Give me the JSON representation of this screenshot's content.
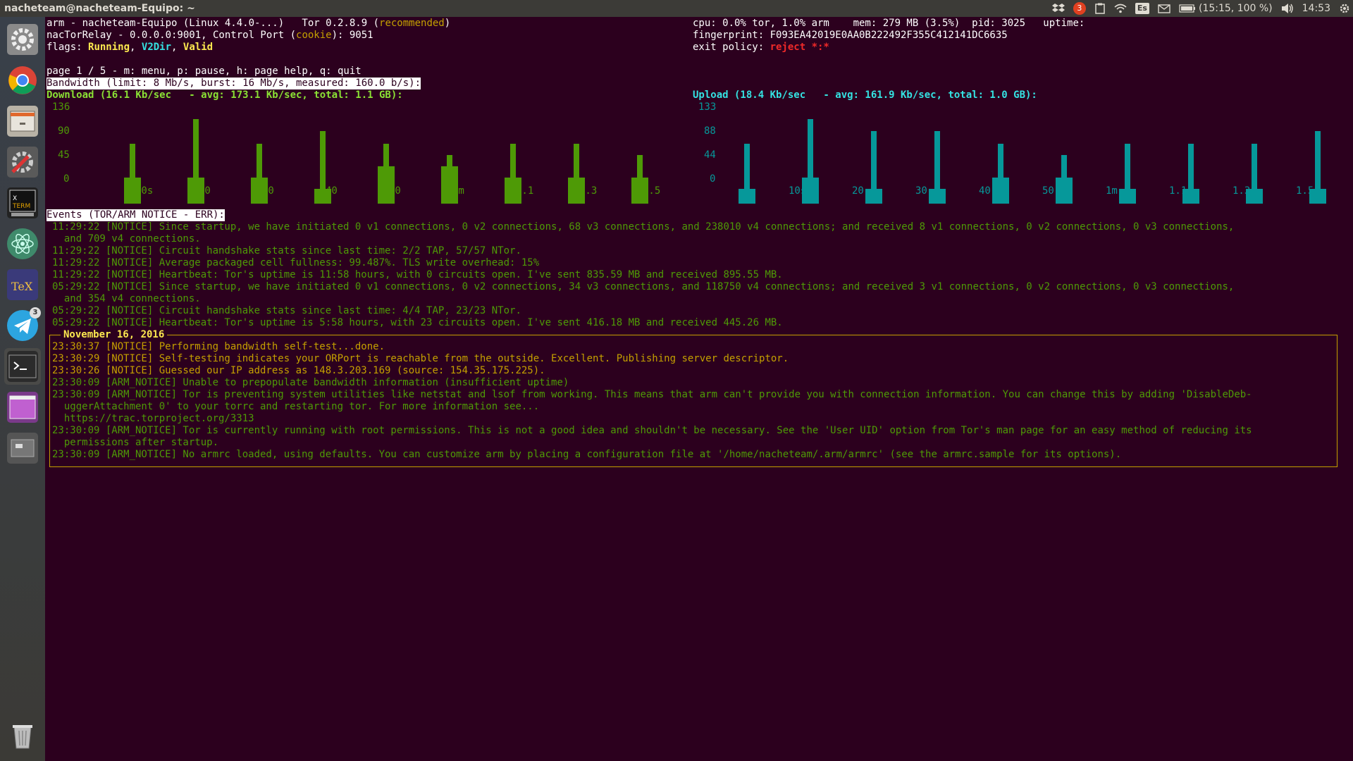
{
  "window": {
    "title": "nacheteam@nacheteam-Equipo: ~"
  },
  "tray": {
    "notification_count": "3",
    "keyboard_layout": "Es",
    "battery_text": "(15:15, 100 %)",
    "clock": "14:53"
  },
  "launcher": {
    "telegram_badge": "3",
    "items": [
      "System Settings",
      "Chromium",
      "Files",
      "Software Updater",
      "XTerm",
      "Atom",
      "TeXstudio",
      "Telegram",
      "Terminal",
      "Workspaces",
      "Drive",
      "Trash"
    ]
  },
  "header": {
    "line1_left": "arm - nacheteam-Equipo (Linux 4.4.0-...)   Tor 0.2.8.9 (",
    "line1_recommended": "recommended",
    "line1_close": ")",
    "line2_pre": "nacTorRelay - 0.0.0.0:9001, Control Port (",
    "line2_cookie": "cookie",
    "line2_post": "): 9051",
    "flags_label": "flags: ",
    "flag_running": "Running",
    "flag_v2dir": "V2Dir",
    "flag_valid": "Valid",
    "sep": ", ",
    "cpu_line": "cpu: 0.0% tor, 1.0% arm    mem: 279 MB (3.5%)  pid: 3025   uptime:",
    "fingerprint": "fingerprint: F093EA42019E0AA0B222492F355C412141DC6635",
    "exit_policy_label": "exit policy: ",
    "exit_policy_value": "reject *:*",
    "page_line": "page 1 / 5 - m: menu, p: pause, h: page help, q: quit",
    "bandwidth_title": "Bandwidth (limit: 8 Mb/s, burst: 16 Mb/s, measured: 160.0 b/s):"
  },
  "download": {
    "label": "Download (16.1 Kb/sec   - avg: 173.1 Kb/sec, total: 1.1 GB):",
    "yticks": [
      "136",
      "90",
      "45",
      "0"
    ],
    "xticks": [
      "10s",
      "20",
      "30",
      "40",
      "50",
      "1m",
      "1.1",
      "1.3",
      "1.5"
    ],
    "color": "#4e9a06"
  },
  "upload": {
    "label": "Upload (18.4 Kb/sec   - avg: 161.9 Kb/sec, total: 1.0 GB):",
    "yticks": [
      "133",
      "88",
      "44",
      "0"
    ],
    "xticks": [
      "10s",
      "20",
      "30",
      "40",
      "50",
      "1m",
      "1.1",
      "1.3",
      "1.5"
    ],
    "color": "#06989a"
  },
  "events": {
    "title": "Events (TOR/ARM NOTICE - ERR):",
    "lines": [
      "11:29:22 [NOTICE] Since startup, we have initiated 0 v1 connections, 0 v2 connections, 68 v3 connections, and 238010 v4 connections; and received 8 v1 connections, 0 v2 connections, 0 v3 connections,",
      "  and 709 v4 connections.",
      "11:29:22 [NOTICE] Circuit handshake stats since last time: 2/2 TAP, 57/57 NTor.",
      "11:29:22 [NOTICE] Average packaged cell fullness: 99.487%. TLS write overhead: 15%",
      "11:29:22 [NOTICE] Heartbeat: Tor's uptime is 11:58 hours, with 0 circuits open. I've sent 835.59 MB and received 895.55 MB.",
      "05:29:22 [NOTICE] Since startup, we have initiated 0 v1 connections, 0 v2 connections, 34 v3 connections, and 118750 v4 connections; and received 3 v1 connections, 0 v2 connections, 0 v3 connections,",
      "  and 354 v4 connections.",
      "05:29:22 [NOTICE] Circuit handshake stats since last time: 4/4 TAP, 23/23 NTor.",
      "05:29:22 [NOTICE] Heartbeat: Tor's uptime is 5:58 hours, with 23 circuits open. I've sent 416.18 MB and received 445.26 MB."
    ],
    "date_label": "November 16, 2016",
    "dated_lines": [
      "23:30:37 [NOTICE] Performing bandwidth self-test...done.",
      "23:30:29 [NOTICE] Self-testing indicates your ORPort is reachable from the outside. Excellent. Publishing server descriptor.",
      "23:30:26 [NOTICE] Guessed our IP address as 148.3.203.169 (source: 154.35.175.225).",
      "23:30:09 [ARM_NOTICE] Unable to prepopulate bandwidth information (insufficient uptime)",
      "23:30:09 [ARM_NOTICE] Tor is preventing system utilities like netstat and lsof from working. This means that arm can't provide you with connection information. You can change this by adding 'DisableDeb-",
      "  uggerAttachment 0' to your torrc and restarting tor. For more information see...",
      "  https://trac.torproject.org/3313",
      "23:30:09 [ARM_NOTICE] Tor is currently running with root permissions. This is not a good idea and shouldn't be necessary. See the 'User UID' option from Tor's man page for an easy method of reducing its",
      "  permissions after startup.",
      "23:30:09 [ARM_NOTICE] No armrc loaded, using defaults. You can customize arm by placing a configuration file at '/home/nacheteam/.arm/armrc' (see the armrc.sample for its options)."
    ]
  }
}
